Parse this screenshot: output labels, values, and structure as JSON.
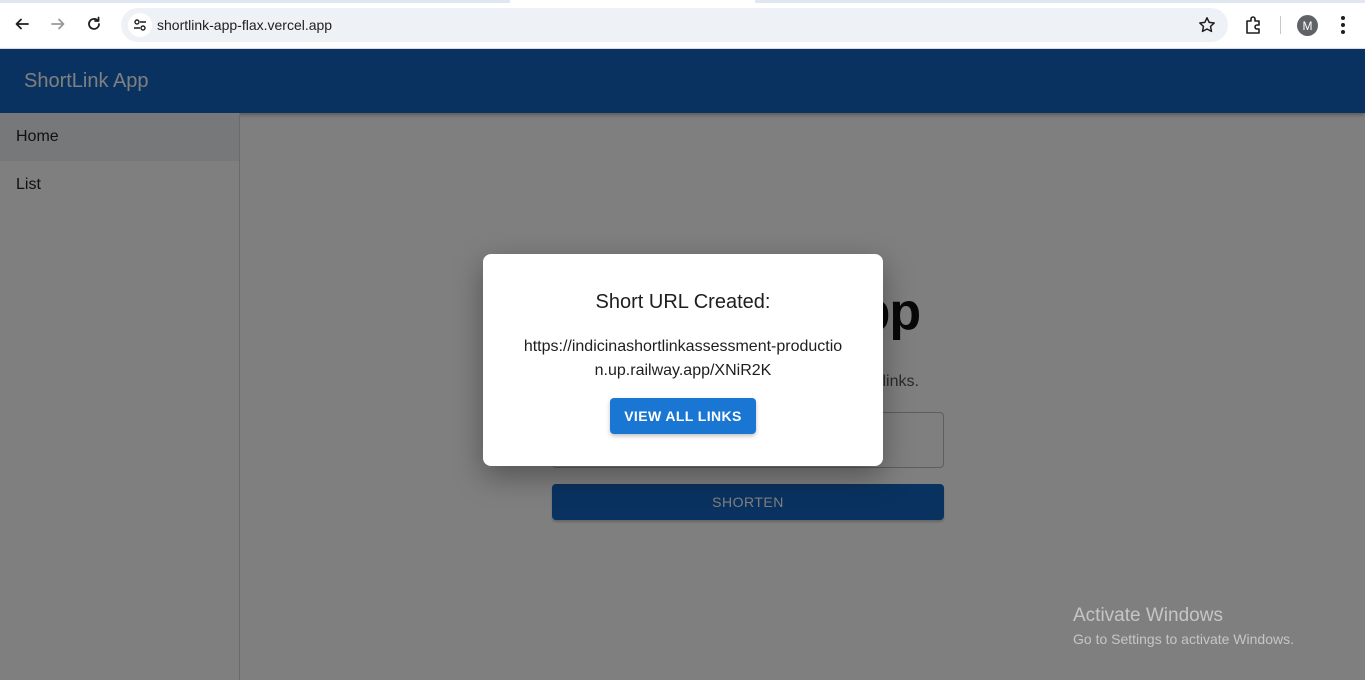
{
  "browser": {
    "url": "shortlink-app-flax.vercel.app",
    "avatar_letter": "M"
  },
  "app": {
    "title": "ShortLink App"
  },
  "sidebar": {
    "items": [
      {
        "label": "Home",
        "active": true
      },
      {
        "label": "List",
        "active": false
      }
    ]
  },
  "main": {
    "hero_title": "ShortLink App",
    "hero_subtitle": "Paste your long URL below to create short links.",
    "url_input_value": "",
    "shorten_label": "SHORTEN"
  },
  "dialog": {
    "title": "Short URL Created:",
    "short_url": "https://indicinashortlinkassessment-production.up.railway.app/XNiR2K",
    "button_label": "VIEW ALL LINKS"
  },
  "os_watermark": {
    "line1": "Activate Windows",
    "line2": "Go to Settings to activate Windows."
  },
  "colors": {
    "app_bar": "#1565c0",
    "dialog_button": "#1976d2",
    "backdrop": "rgba(0,0,0,0.5)"
  }
}
